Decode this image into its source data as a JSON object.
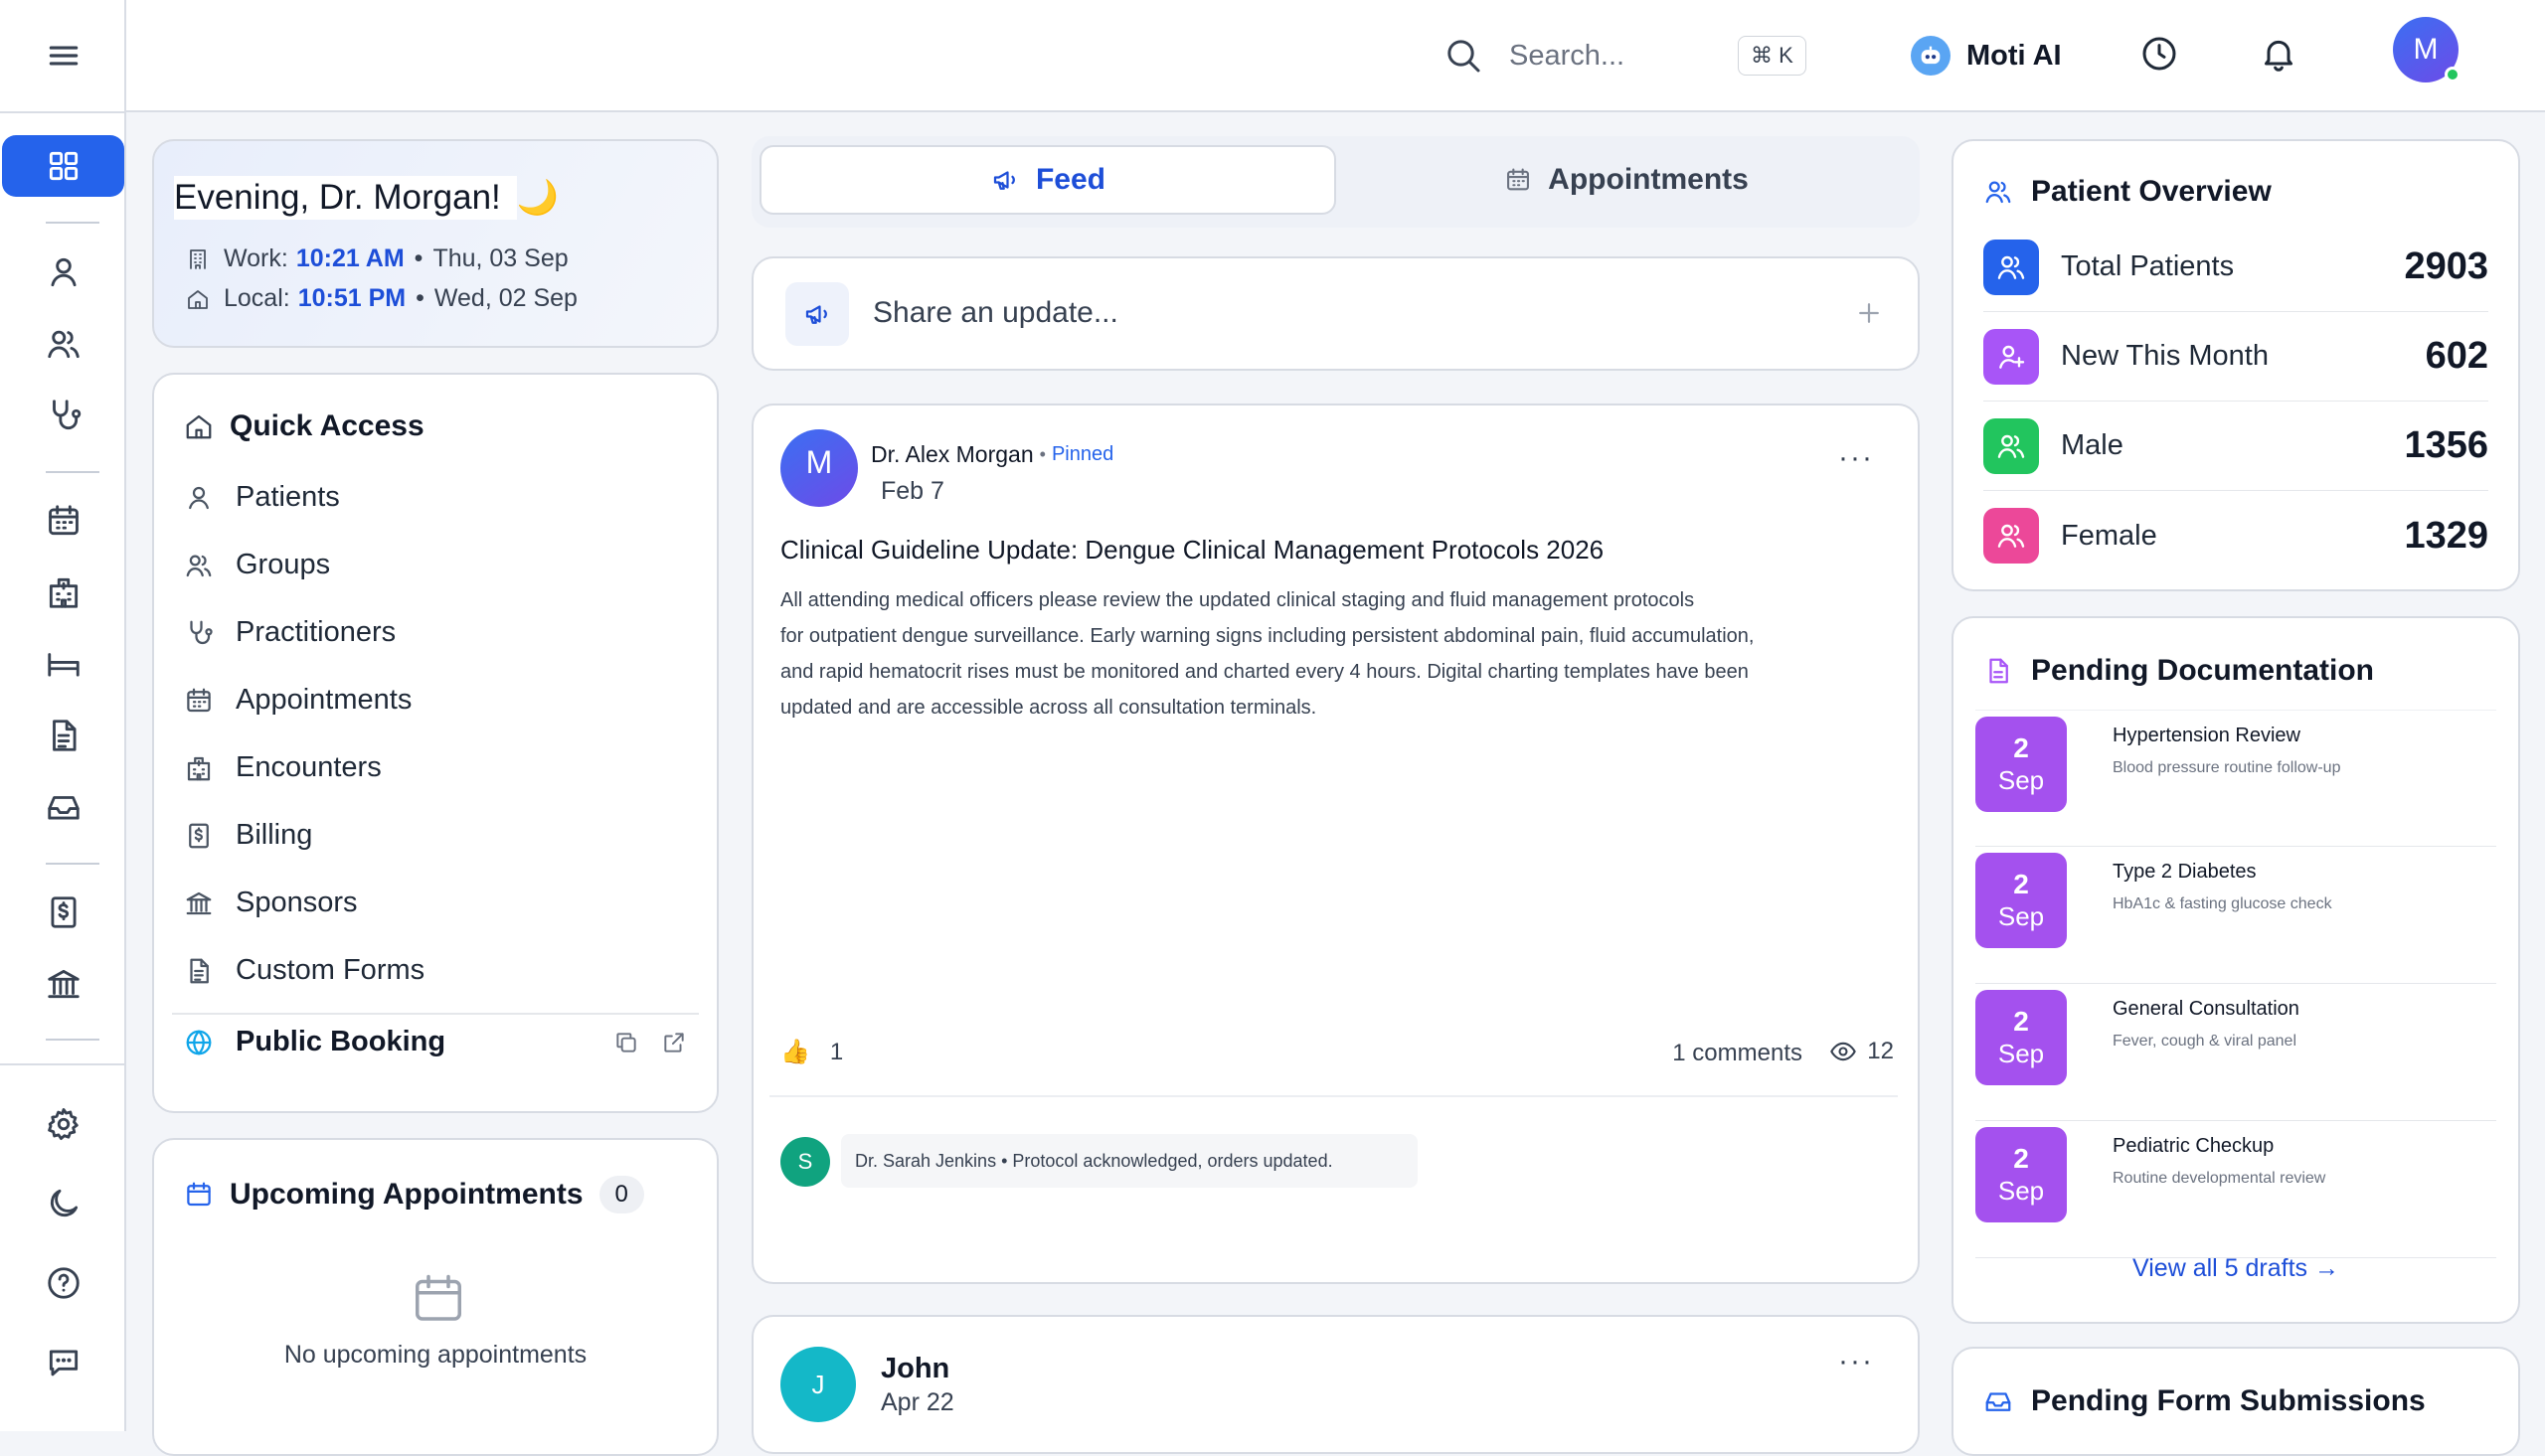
{
  "search": {
    "placeholder": "Search...",
    "shortcut": "⌘ K"
  },
  "header": {
    "ai_label": "Moti AI",
    "avatar_initial": "M"
  },
  "greeting": {
    "title": "Evening, Dr. Morgan!",
    "emoji": "🌙",
    "work_label": "Work:",
    "work_time": "10:21 AM",
    "work_date": "Thu, 03 Sep",
    "local_label": "Local:",
    "local_time": "10:51 PM",
    "local_date": "Wed, 02 Sep",
    "separator": "•"
  },
  "quick_access": {
    "title": "Quick Access",
    "items": [
      {
        "label": "Patients",
        "icon": "user-icon"
      },
      {
        "label": "Groups",
        "icon": "users-icon"
      },
      {
        "label": "Practitioners",
        "icon": "stethoscope-icon"
      },
      {
        "label": "Appointments",
        "icon": "calendar-icon"
      },
      {
        "label": "Encounters",
        "icon": "hospital-icon"
      },
      {
        "label": "Billing",
        "icon": "dollar-receipt-icon"
      },
      {
        "label": "Sponsors",
        "icon": "bank-icon"
      },
      {
        "label": "Custom Forms",
        "icon": "file-text-icon"
      }
    ],
    "public_booking": "Public Booking"
  },
  "upcoming": {
    "title": "Upcoming Appointments",
    "count": "0",
    "empty": "No upcoming appointments"
  },
  "tabs": {
    "feed": "Feed",
    "appointments": "Appointments"
  },
  "share": {
    "placeholder": "Share an update..."
  },
  "post": {
    "avatar_initial": "M",
    "author": "Dr. Alex Morgan",
    "sep": "•",
    "pinned": "Pinned",
    "date": "Feb 7",
    "title": "Clinical Guideline Update: Dengue Clinical Management Protocols 2026",
    "body_lines": [
      "All attending medical officers please review the updated clinical staging and fluid management protocols",
      "for outpatient dengue surveillance. Early warning signs including persistent abdominal pain, fluid accumulation,",
      "and rapid hematocrit rises must be monitored and charted every 4 hours. Digital charting templates have been",
      "updated and are accessible across all consultation terminals."
    ],
    "likes": "1",
    "comments": "1 comments",
    "views": "12",
    "comment_avatar": "S",
    "comment_text": "Dr. Sarah Jenkins • Protocol acknowledged, orders updated."
  },
  "post2": {
    "avatar_initial": "J",
    "author": "John",
    "date": "Apr 22"
  },
  "patient_overview": {
    "title": "Patient Overview",
    "rows": [
      {
        "label": "Total Patients",
        "value": "2903",
        "color": "#2563eb"
      },
      {
        "label": "New This Month",
        "value": "602",
        "color": "#a855f7"
      },
      {
        "label": "Male",
        "value": "1356",
        "color": "#22c55e"
      },
      {
        "label": "Female",
        "value": "1329",
        "color": "#ec4899"
      }
    ]
  },
  "pending_docs": {
    "title": "Pending Documentation",
    "items": [
      {
        "day": "2",
        "month": "Sep",
        "title": "Hypertension Review",
        "sub": "Blood pressure routine follow-up"
      },
      {
        "day": "2",
        "month": "Sep",
        "title": "Type 2 Diabetes",
        "sub": "HbA1c & fasting glucose check"
      },
      {
        "day": "2",
        "month": "Sep",
        "title": "General Consultation",
        "sub": "Fever, cough & viral panel"
      },
      {
        "day": "2",
        "month": "Sep",
        "title": "Pediatric Checkup",
        "sub": "Routine developmental review"
      }
    ],
    "view_all": "View all 5 drafts →"
  },
  "pending_forms": {
    "title": "Pending Form Submissions"
  },
  "colors": {
    "accent": "#2563eb",
    "doc_badge": "#a451ee",
    "comment_avatar": "#10a37f",
    "post2_avatar": "#14b8c8"
  }
}
